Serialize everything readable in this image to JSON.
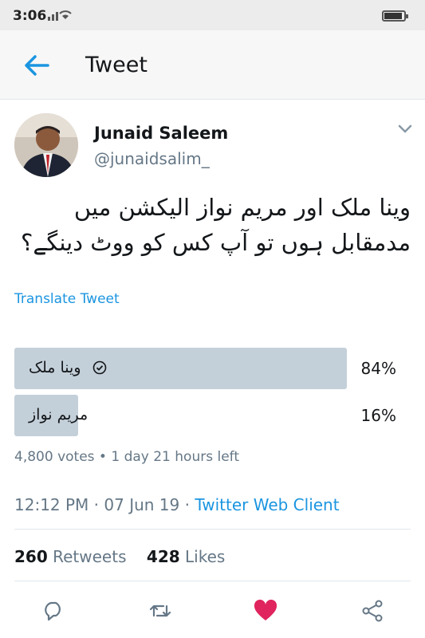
{
  "status_bar": {
    "time": "3:06",
    "signal": "ˣᴵᴵᴵ"
  },
  "header": {
    "title": "Tweet"
  },
  "author": {
    "name": "Junaid Saleem",
    "handle": "@junaidsalim_"
  },
  "tweet": {
    "text_line1": "وینا ملک اور مریم نواز الیکشن میں",
    "text_line2": "مدمقابل ہوں تو آپ کس کو ووٹ دینگے؟",
    "translate_label": "Translate Tweet"
  },
  "poll": {
    "options": [
      {
        "label": "وینا ملک",
        "percent": "84%",
        "fraction": 0.84,
        "selected": true
      },
      {
        "label": "مریم نواز",
        "percent": "16%",
        "fraction": 0.16,
        "selected": false
      }
    ],
    "meta": "4,800 votes • 1 day 21 hours left"
  },
  "timestamp": {
    "time": "12:12 PM · 07 Jun 19 · ",
    "source": "Twitter Web Client"
  },
  "stats": {
    "retweets_count": "260",
    "retweets_label": "Retweets",
    "likes_count": "428",
    "likes_label": "Likes"
  },
  "colors": {
    "accent": "#1b95e0",
    "like_red": "#e0245e",
    "poll_bar": "#c4d0d9",
    "muted": "#657786"
  },
  "icons": [
    "back-arrow-icon",
    "caret-down-icon",
    "check-circle-icon",
    "reply-icon",
    "retweet-icon",
    "heart-icon",
    "share-icon"
  ]
}
